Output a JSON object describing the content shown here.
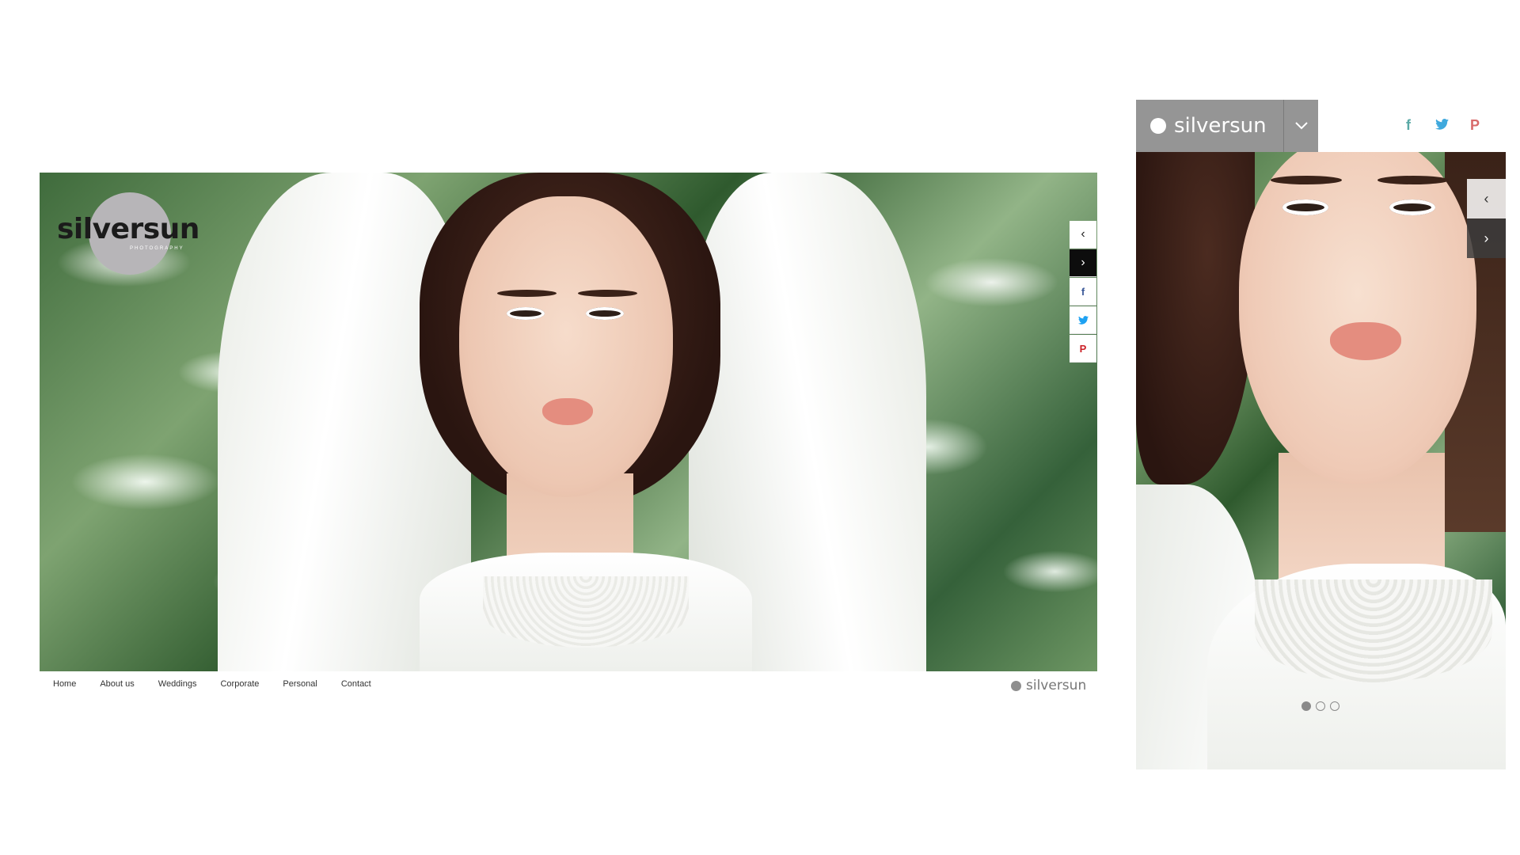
{
  "brand": {
    "logo_text": "silversun",
    "logo_sub": "PHOTOGRAPHY",
    "gray": "#b7b5b8"
  },
  "desktop": {
    "controls": [
      {
        "name": "prev-arrow",
        "icon": "chevron-left-icon",
        "glyph": "‹"
      },
      {
        "name": "next-arrow",
        "icon": "chevron-right-icon",
        "glyph": "›"
      },
      {
        "name": "facebook-share",
        "icon": "facebook-icon",
        "glyph": "f"
      },
      {
        "name": "twitter-share",
        "icon": "twitter-icon",
        "glyph": "🐦"
      },
      {
        "name": "pinterest-share",
        "icon": "pinterest-icon",
        "glyph": "P"
      }
    ],
    "nav": [
      "Home",
      "About us",
      "Weddings",
      "Corporate",
      "Personal",
      "Contact"
    ],
    "footer_logo_text": "silversun"
  },
  "mobile": {
    "header_logo_text": "silversun",
    "menu_icon": "chevron-down-icon",
    "social": [
      {
        "icon": "facebook-icon",
        "glyph": "f"
      },
      {
        "icon": "twitter-icon",
        "glyph": "🐦"
      },
      {
        "icon": "pinterest-icon",
        "glyph": "P"
      }
    ],
    "controls": [
      {
        "icon": "chevron-left-icon",
        "glyph": "‹"
      },
      {
        "icon": "chevron-right-icon",
        "glyph": "›"
      }
    ],
    "pagination": {
      "total": 3,
      "active": 1
    }
  }
}
